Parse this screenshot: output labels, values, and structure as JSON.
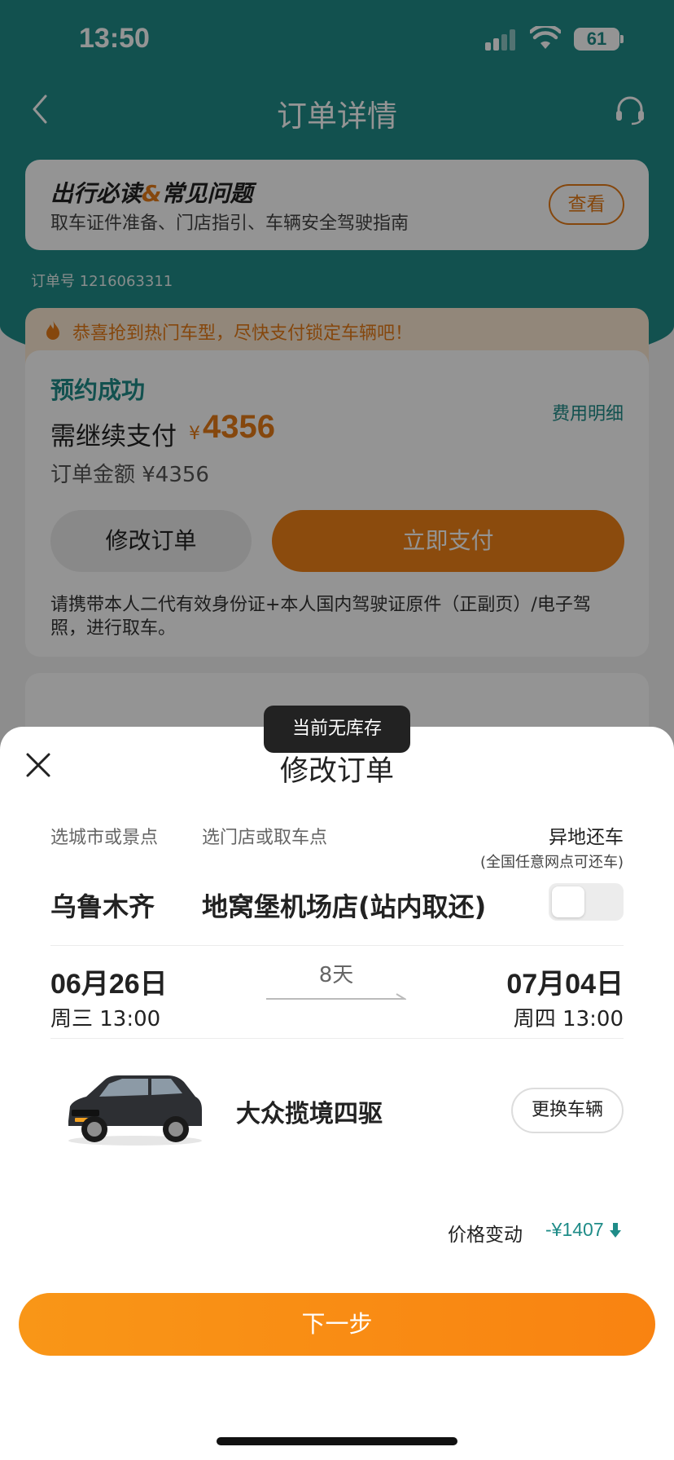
{
  "status_bar": {
    "time": "13:50",
    "battery": "61"
  },
  "nav": {
    "title": "订单详情"
  },
  "faq": {
    "title_part1": "出行必读",
    "title_amp": "&",
    "title_part2": "常见问题",
    "subtitle": "取车证件准备、门店指引、车辆安全驾驶指南",
    "view_button": "查看"
  },
  "order": {
    "number_text": "订单号 1216063311"
  },
  "hot_banner": {
    "text": "恭喜抢到热门车型，尽快支付锁定车辆吧！"
  },
  "main_card": {
    "status": "预约成功",
    "fee_detail": "费用明细",
    "pay_label": "需继续支付",
    "currency": "¥",
    "amount": "4356",
    "total": "订单金额 ¥4356",
    "edit_button": "修改订单",
    "pay_button": "立即支付",
    "note": "请携带本人二代有效身份证+本人国内驾驶证原件（正副页）/电子驾照，进行取车。"
  },
  "toast": {
    "text": "当前无库存"
  },
  "sheet": {
    "title": "修改订单",
    "label_city": "选城市或景点",
    "label_store": "选门店或取车点",
    "label_diff_return": "异地还车",
    "label_diff_return_sub": "(全国任意网点可还车)",
    "city": "乌鲁木齐",
    "store": "地窝堡机场店(站内取还)",
    "diff_return_enabled": false,
    "start_date": "06月26日",
    "start_day": "周三 13:00",
    "duration": "8天",
    "end_date": "07月04日",
    "end_day": "周四 13:00",
    "car_name": "大众揽境四驱",
    "change_car_button": "更换车辆",
    "price_change_label": "价格变动",
    "price_change_value": "-¥1407",
    "next_button": "下一步"
  },
  "colors": {
    "teal": "#1f8c88",
    "orange": "#f08118",
    "brand_orange_text": "#e57a17"
  },
  "icons": {
    "back": "chevron-left-icon",
    "support": "headset-icon",
    "flame": "flame-icon",
    "close": "close-icon",
    "price_down": "arrow-down-icon"
  }
}
